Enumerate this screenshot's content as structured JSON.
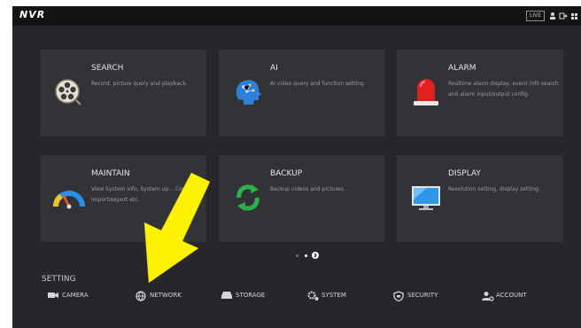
{
  "topbar": {
    "logo": "NVR",
    "live_label": "LIVE"
  },
  "tiles": [
    {
      "title": "SEARCH",
      "description": "Record, picture query and playback.",
      "icon": "film-reel-search-icon"
    },
    {
      "title": "AI",
      "description": "AI video query and function setting.",
      "icon": "ai-head-icon"
    },
    {
      "title": "ALARM",
      "description": "Realtime alarm display, event info search and alarm input/output config.",
      "icon": "alarm-siren-icon"
    },
    {
      "title": "MAINTAIN",
      "description": "View System info, System up... Config import/export etc.",
      "icon": "gauge-icon"
    },
    {
      "title": "BACKUP",
      "description": "Backup videos and pictures.",
      "icon": "refresh-arrows-icon"
    },
    {
      "title": "DISPLAY",
      "description": "Resolution setting, display setting.",
      "icon": "monitor-icon"
    }
  ],
  "setting": {
    "label": "SETTING",
    "items": [
      {
        "label": "CAMERA",
        "icon": "camera-icon"
      },
      {
        "label": "NETWORK",
        "icon": "globe-icon"
      },
      {
        "label": "STORAGE",
        "icon": "hard-drive-icon"
      },
      {
        "label": "SYSTEM",
        "icon": "gears-icon"
      },
      {
        "label": "SECURITY",
        "icon": "shield-icon"
      },
      {
        "label": "ACCOUNT",
        "icon": "user-gear-icon"
      }
    ]
  },
  "colors": {
    "background": "#25272b",
    "tile": "#313337",
    "topbar": "#131416",
    "annotation_arrow": "#fff200"
  }
}
